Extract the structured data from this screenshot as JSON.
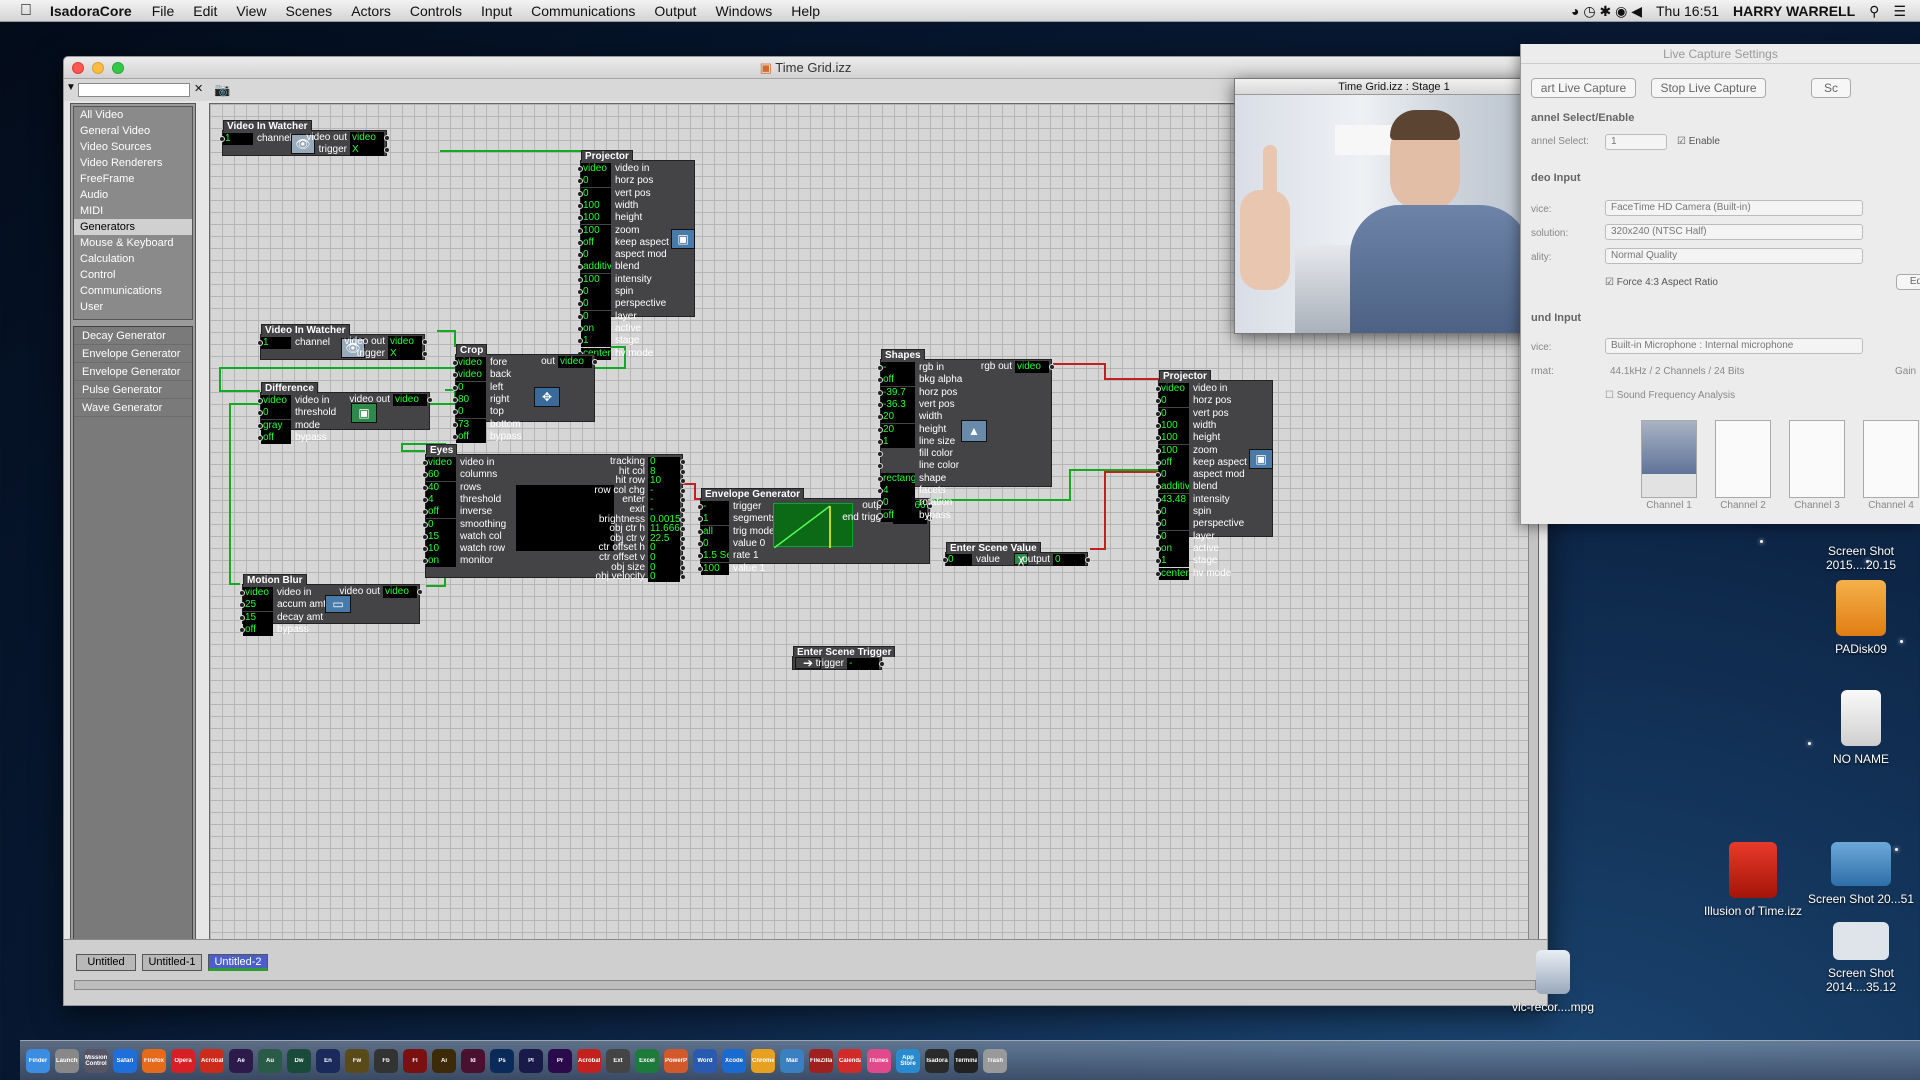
{
  "menubar": {
    "app": "IsadoraCore",
    "items": [
      "File",
      "Edit",
      "View",
      "Scenes",
      "Actors",
      "Controls",
      "Input",
      "Communications",
      "Output",
      "Windows",
      "Help"
    ],
    "clock": "Thu 16:51",
    "user": "HARRY WARRELL"
  },
  "window": {
    "title": "Time Grid.izz"
  },
  "categories": [
    "All Video",
    "General Video",
    "Video Sources",
    "Video Renderers",
    "FreeFrame",
    "Audio",
    "MIDI",
    "Generators",
    "Mouse & Keyboard",
    "Calculation",
    "Control",
    "Communications",
    "User"
  ],
  "selected_category": "Generators",
  "actor_list": [
    "Decay Generator",
    "Envelope Generator",
    "Envelope Generator",
    "Pulse Generator",
    "Wave Generator"
  ],
  "tabs": [
    "Untitled",
    "Untitled-1",
    "Untitled-2"
  ],
  "actors": {
    "viw1": {
      "title": "Video In Watcher",
      "channel": "1",
      "out": "video",
      "trigger": "X"
    },
    "viw2": {
      "title": "Video In Watcher",
      "channel": "1",
      "out": "video",
      "trigger": "X"
    },
    "proj1": {
      "title": "Projector",
      "rows": [
        [
          "video",
          "video in"
        ],
        [
          "0",
          "horz pos"
        ],
        [
          "0",
          "vert pos"
        ],
        [
          "100",
          "width"
        ],
        [
          "100",
          "height"
        ],
        [
          "100",
          "zoom"
        ],
        [
          "off",
          "keep aspect"
        ],
        [
          "0",
          "aspect mod"
        ],
        [
          "additive",
          "blend"
        ],
        [
          "100",
          "intensity"
        ],
        [
          "0",
          "spin"
        ],
        [
          "0",
          "perspective"
        ],
        [
          "0",
          "layer"
        ],
        [
          "on",
          "active"
        ],
        [
          "1",
          "stage"
        ],
        [
          "centered",
          "hv mode"
        ]
      ]
    },
    "crop": {
      "title": "Crop",
      "rows": [
        [
          "video",
          "fore"
        ],
        [
          "video",
          "back"
        ],
        [
          "0",
          "left"
        ],
        [
          "80",
          "right"
        ],
        [
          "0",
          "top"
        ],
        [
          "73",
          "bottom"
        ],
        [
          "off",
          "bypass"
        ]
      ],
      "out": "video"
    },
    "diff": {
      "title": "Difference",
      "rows": [
        [
          "video",
          "video in"
        ],
        [
          "0",
          "threshold"
        ],
        [
          "gray",
          "mode"
        ],
        [
          "off",
          "bypass"
        ]
      ],
      "out": "video"
    },
    "eyes": {
      "title": "Eyes",
      "rows": [
        [
          "video",
          "video in"
        ],
        [
          "60",
          "columns"
        ],
        [
          "40",
          "rows"
        ],
        [
          "4",
          "threshold"
        ],
        [
          "off",
          "inverse"
        ],
        [
          "0",
          "smoothing"
        ],
        [
          "15",
          "watch col"
        ],
        [
          "10",
          "watch row"
        ],
        [
          "on",
          "monitor"
        ]
      ],
      "outs": [
        [
          "tracking",
          "0"
        ],
        [
          "hit col",
          "8"
        ],
        [
          "hit row",
          "10"
        ],
        [
          "row col chg",
          "-"
        ],
        [
          "enter",
          "-"
        ],
        [
          "exit",
          "-"
        ],
        [
          "brightness",
          "0.0015"
        ],
        [
          "obj ctr h",
          "11.6667"
        ],
        [
          "obj ctr v",
          "22.5"
        ],
        [
          "ctr offset h",
          "0"
        ],
        [
          "ctr offset v",
          "0"
        ],
        [
          "obj size",
          "0"
        ],
        [
          "obj velocity",
          "0"
        ]
      ]
    },
    "env": {
      "title": "Envelope Generator",
      "rows": [
        [
          "-",
          "trigger"
        ],
        [
          "1",
          "segments"
        ],
        [
          "all",
          "trig mode"
        ],
        [
          "0",
          "value 0"
        ],
        [
          "1.5 Sec",
          "rate 1"
        ],
        [
          "100",
          "value 1"
        ]
      ],
      "output": "72.4667",
      "end_trigger": "-"
    },
    "mblur": {
      "title": "Motion Blur",
      "rows": [
        [
          "video",
          "video in"
        ],
        [
          "25",
          "accum amt"
        ],
        [
          "15",
          "decay amt"
        ],
        [
          "off",
          "bypass"
        ]
      ],
      "out": "video"
    },
    "shapes": {
      "title": "Shapes",
      "rows": [
        [
          "-",
          "rgb in"
        ],
        [
          "off",
          "bkg alpha"
        ],
        [
          "-39.7",
          "horz pos"
        ],
        [
          "-36.3",
          "vert pos"
        ],
        [
          "20",
          "width"
        ],
        [
          "20",
          "height"
        ],
        [
          "1",
          "line size"
        ],
        [
          "",
          "fill color"
        ],
        [
          "",
          "line color"
        ],
        [
          "rectangle",
          "shape"
        ],
        [
          "4",
          "facets"
        ],
        [
          "0",
          "rotation"
        ],
        [
          "off",
          "bypass"
        ]
      ],
      "out": "video"
    },
    "proj2": {
      "title": "Projector",
      "rows": [
        [
          "video",
          "video in"
        ],
        [
          "0",
          "horz pos"
        ],
        [
          "0",
          "vert pos"
        ],
        [
          "100",
          "width"
        ],
        [
          "100",
          "height"
        ],
        [
          "100",
          "zoom"
        ],
        [
          "off",
          "keep aspect"
        ],
        [
          "0",
          "aspect mod"
        ],
        [
          "additive",
          "blend"
        ],
        [
          "43.48",
          "intensity"
        ],
        [
          "0",
          "spin"
        ],
        [
          "0",
          "perspective"
        ],
        [
          "0",
          "layer"
        ],
        [
          "on",
          "active"
        ],
        [
          "1",
          "stage"
        ],
        [
          "centered",
          "hv mode"
        ]
      ]
    },
    "esv": {
      "title": "Enter Scene Value",
      "in": "0",
      "value_label": "value",
      "out_label": "output",
      "out": "0"
    },
    "est": {
      "title": "Enter Scene Trigger",
      "label": "trigger",
      "out": "-"
    }
  },
  "stage": {
    "title": "Time Grid.izz : Stage 1"
  },
  "live_capture": {
    "title": "Live Capture Settings",
    "start": "art Live Capture",
    "stop": "Stop Live Capture",
    "s_cut": "Sc",
    "channel_head": "annel Select/Enable",
    "channel_label": "annel Select:",
    "channel_value": "1",
    "enable": "Enable",
    "video_head": "deo Input",
    "device_label": "vice:",
    "device": "FaceTime HD Camera (Built-in)",
    "res_label": "solution:",
    "res": "320x240 (NTSC Half)",
    "qual_label": "ality:",
    "qual": "Normal Quality",
    "force": "Force 4:3 Aspect Ratio",
    "edit": "Ed",
    "sound_head": "und Input",
    "sdev_label": "vice:",
    "sdev": "Built-in Microphone : Internal microphone",
    "fmt_label": "rmat:",
    "fmt": "44.1kHz / 2 Channels / 24 Bits",
    "gain": "Gain",
    "freq": "Sound Frequency Analysis",
    "channels": [
      "Channel 1",
      "Channel 2",
      "Channel 3",
      "Channel 4"
    ]
  },
  "desktop": [
    {
      "label": "Screen Shot 2015....20.15"
    },
    {
      "label": "PADisk09"
    },
    {
      "label": "NO NAME"
    },
    {
      "label": "Illusion of Time.izz"
    },
    {
      "label": "Screen Shot 20...51"
    },
    {
      "label": "Screen Shot 2014....35.12"
    },
    {
      "label": "vlc-recor....mpg"
    }
  ],
  "dock_apps": [
    "Finder",
    "Launchpad",
    "Mission Control",
    "Safari",
    "Firefox",
    "Opera",
    "Acrobat",
    "Ae",
    "Au",
    "Dw",
    "En",
    "Fw",
    "Fb",
    "Fl",
    "Ai",
    "Id",
    "Ps",
    "Pl",
    "Pr",
    "Acrobat",
    "Ext",
    "Excel",
    "PowerPoint",
    "Word",
    "Xcode",
    "Chrome",
    "Mail",
    "FileZilla",
    "Calendar",
    "iTunes",
    "App Store",
    "Isadora",
    "Terminal",
    "Trash"
  ]
}
